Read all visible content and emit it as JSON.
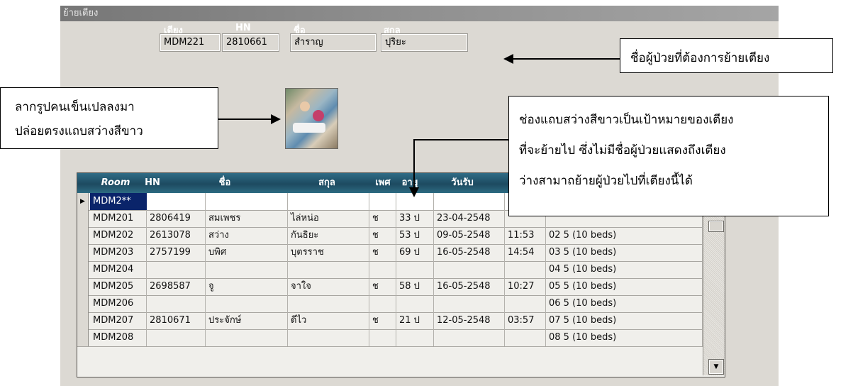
{
  "window": {
    "title": "ย้ายเตียง"
  },
  "header": {
    "labels": {
      "bed": "เตียง",
      "hn": "HN",
      "first_name": "ชื่อ",
      "last_name": "สกุล"
    },
    "values": {
      "bed": "MDM221",
      "hn": "2810661",
      "first_name": "สำราญ",
      "last_name": "ปุริยะ"
    }
  },
  "image": {
    "icon": "patient-photo"
  },
  "grid": {
    "columns": [
      "Room",
      "HN",
      "ชื่อ",
      "สกุล",
      "เพศ",
      "อายุ",
      "วันรับ"
    ],
    "new_row": {
      "room": "MDM2**"
    },
    "rows": [
      {
        "room": "MDM201",
        "hn": "2806419",
        "first_name": "สมเพชร",
        "last_name": "ไล่หน่อ",
        "sex": "ช",
        "age": "33 ป",
        "date": "23-04-2548",
        "time": "",
        "ward": ""
      },
      {
        "room": "MDM202",
        "hn": "2613078",
        "first_name": "สว่าง",
        "last_name": "กันธิยะ",
        "sex": "ช",
        "age": "53 ป",
        "date": "09-05-2548",
        "time": "11:53",
        "ward": "02 5 (10 beds)"
      },
      {
        "room": "MDM203",
        "hn": "2757199",
        "first_name": "บพิศ",
        "last_name": "บุตรราช",
        "sex": "ช",
        "age": "69 ป",
        "date": "16-05-2548",
        "time": "14:54",
        "ward": "03 5 (10 beds)"
      },
      {
        "room": "MDM204",
        "hn": "",
        "first_name": "",
        "last_name": "",
        "sex": "",
        "age": "",
        "date": "",
        "time": "",
        "ward": "04 5 (10 beds)"
      },
      {
        "room": "MDM205",
        "hn": "2698587",
        "first_name": "จู",
        "last_name": "จาใจ",
        "sex": "ช",
        "age": "58 ป",
        "date": "16-05-2548",
        "time": "10:27",
        "ward": "05 5 (10 beds)"
      },
      {
        "room": "MDM206",
        "hn": "",
        "first_name": "",
        "last_name": "",
        "sex": "",
        "age": "",
        "date": "",
        "time": "",
        "ward": "06 5 (10 beds)"
      },
      {
        "room": "MDM207",
        "hn": "2810671",
        "first_name": "ประจักษ์",
        "last_name": "ดีไว",
        "sex": "ช",
        "age": "21 ป",
        "date": "12-05-2548",
        "time": "03:57",
        "ward": "07 5 (10 beds)"
      },
      {
        "room": "MDM208",
        "hn": "",
        "first_name": "",
        "last_name": "",
        "sex": "",
        "age": "",
        "date": "",
        "time": "",
        "ward": "08 5 (10 beds)"
      }
    ]
  },
  "callouts": {
    "patient_name": "ชื่อผู้ป่วยที่ต้องการย้ายเตียง",
    "drag_line1": "ลากรูปคนเข็นเปลลงมา",
    "drag_line2": "ปล่อยตรงแถบสว่างสีขาว",
    "target_line1": "ช่องแถบสว่างสีขาวเป็นเป้าหมายของเตียง",
    "target_line2": "ที่จะย้ายไป ซึ่งไม่มีชื่อผู้ป่วยแสดงถึงเตียง",
    "target_line3": "ว่างสามาถย้ายผู้ป่วยไปที่เตียงนี้ได้"
  },
  "icons": {
    "row_selector": "triangle-right-icon",
    "scroll_down": "triangle-down-icon"
  }
}
